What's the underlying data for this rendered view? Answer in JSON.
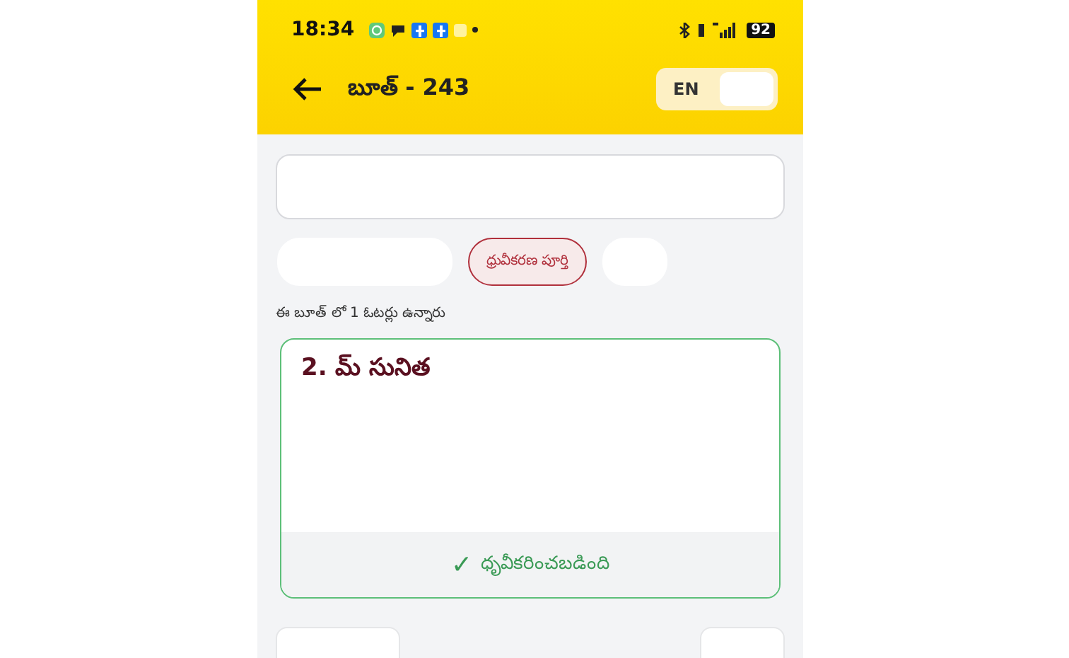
{
  "status_bar": {
    "time": "18:34",
    "battery": "92"
  },
  "header": {
    "title": "బూత్ - 243",
    "language_toggle": {
      "label": "EN"
    }
  },
  "filter_chip": {
    "label": "ధ్రువీకరణ పూర్తి",
    "selected": true
  },
  "voter_count": "ఈ బూత్ లో 1 ఓటర్లు ఉన్నారు",
  "voters": [
    {
      "name": "2. మ్ సునిత",
      "verified": true,
      "status": "ధృవీకరించబడింది",
      "status_icon": "✓"
    }
  ]
}
